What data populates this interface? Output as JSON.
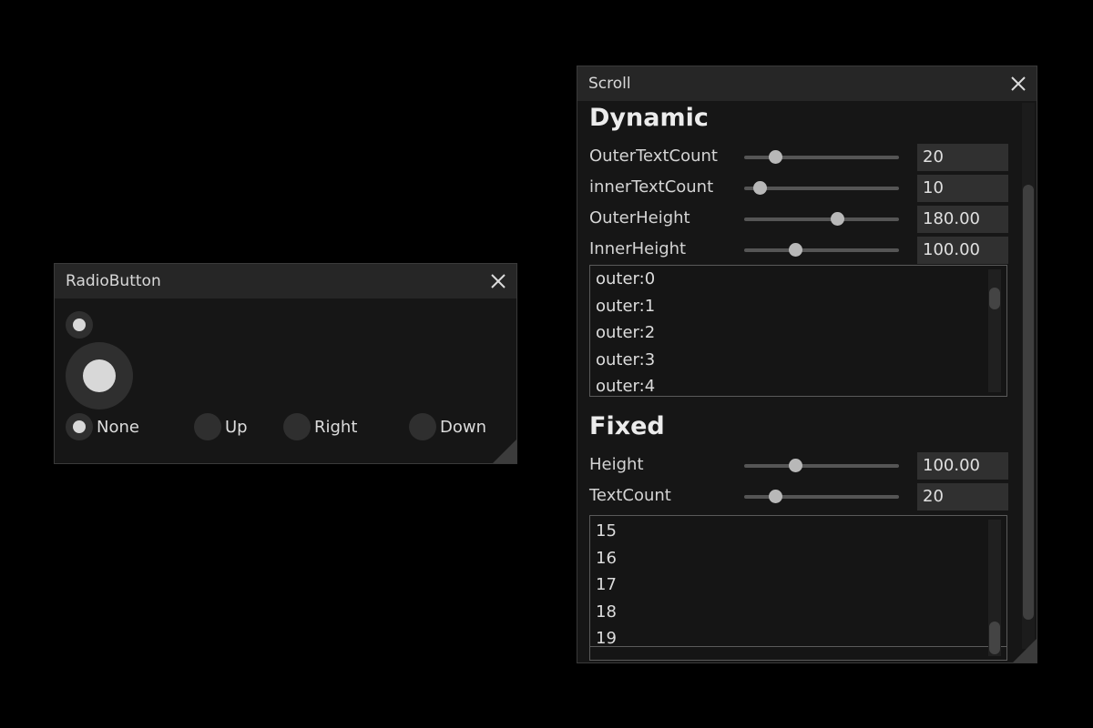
{
  "radio_window": {
    "title": "RadioButton",
    "options": [
      {
        "label": "None",
        "selected": true
      },
      {
        "label": "Up",
        "selected": false
      },
      {
        "label": "Right",
        "selected": false
      },
      {
        "label": "Down",
        "selected": false
      }
    ]
  },
  "scroll_window": {
    "title": "Scroll",
    "dynamic": {
      "heading": "Dynamic",
      "rows": [
        {
          "label": "OuterTextCount",
          "value": "20",
          "slider_fraction": 0.2
        },
        {
          "label": "innerTextCount",
          "value": "10",
          "slider_fraction": 0.1
        },
        {
          "label": "OuterHeight",
          "value": "180.00",
          "slider_fraction": 0.6
        },
        {
          "label": "InnerHeight",
          "value": "100.00",
          "slider_fraction": 0.33
        }
      ],
      "list_items": [
        "outer:0",
        "outer:1",
        "outer:2",
        "outer:3",
        "outer:4"
      ]
    },
    "fixed": {
      "heading": "Fixed",
      "rows": [
        {
          "label": "Height",
          "value": "100.00",
          "slider_fraction": 0.33
        },
        {
          "label": "TextCount",
          "value": "20",
          "slider_fraction": 0.2
        }
      ],
      "list_items": [
        "15",
        "16",
        "17",
        "18",
        "19"
      ]
    }
  }
}
